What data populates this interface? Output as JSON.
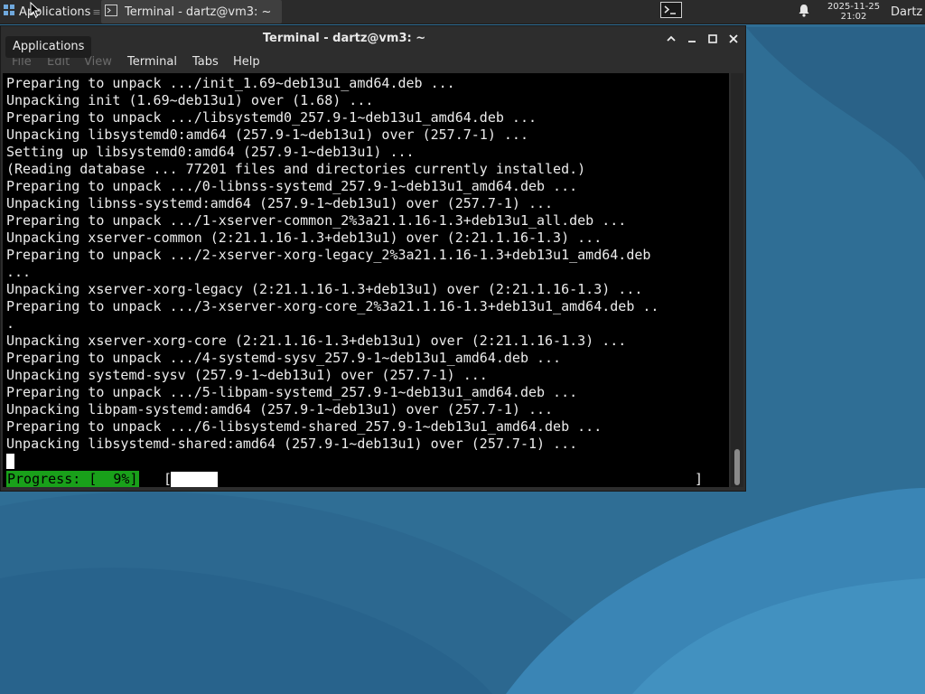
{
  "panel": {
    "applications_label": "Applications",
    "applications_separator": "≡",
    "task_label": "Terminal - dartz@vm3: ~",
    "clock_date": "2025-11-25",
    "clock_time": "21:02",
    "user": "Dartz",
    "icons": [
      "applications-icon",
      "terminal-task-icon",
      "terminal-launcher-icon",
      "notification-bell-icon"
    ]
  },
  "tooltip": {
    "text": "Applications"
  },
  "window": {
    "title": "Terminal - dartz@vm3: ~",
    "controls": [
      "raise-icon",
      "minimize-icon",
      "maximize-icon",
      "close-icon"
    ],
    "menu": [
      "File",
      "Edit",
      "View",
      "Terminal",
      "Tabs",
      "Help"
    ]
  },
  "terminal": {
    "lines": [
      "Preparing to unpack .../init_1.69~deb13u1_amd64.deb ...",
      "Unpacking init (1.69~deb13u1) over (1.68) ...",
      "Preparing to unpack .../libsystemd0_257.9-1~deb13u1_amd64.deb ...",
      "Unpacking libsystemd0:amd64 (257.9-1~deb13u1) over (257.7-1) ...",
      "Setting up libsystemd0:amd64 (257.9-1~deb13u1) ...",
      "(Reading database ... 77201 files and directories currently installed.)",
      "Preparing to unpack .../0-libnss-systemd_257.9-1~deb13u1_amd64.deb ...",
      "Unpacking libnss-systemd:amd64 (257.9-1~deb13u1) over (257.7-1) ...",
      "Preparing to unpack .../1-xserver-common_2%3a21.1.16-1.3+deb13u1_all.deb ...",
      "Unpacking xserver-common (2:21.1.16-1.3+deb13u1) over (2:21.1.16-1.3) ...",
      "Preparing to unpack .../2-xserver-xorg-legacy_2%3a21.1.16-1.3+deb13u1_amd64.deb",
      "...",
      "Unpacking xserver-xorg-legacy (2:21.1.16-1.3+deb13u1) over (2:21.1.16-1.3) ...",
      "Preparing to unpack .../3-xserver-xorg-core_2%3a21.1.16-1.3+deb13u1_amd64.deb ..",
      ".",
      "Unpacking xserver-xorg-core (2:21.1.16-1.3+deb13u1) over (2:21.1.16-1.3) ...",
      "Preparing to unpack .../4-systemd-sysv_257.9-1~deb13u1_amd64.deb ...",
      "Unpacking systemd-sysv (257.9-1~deb13u1) over (257.7-1) ...",
      "Preparing to unpack .../5-libpam-systemd_257.9-1~deb13u1_amd64.deb ...",
      "Unpacking libpam-systemd:amd64 (257.9-1~deb13u1) over (257.7-1) ...",
      "Preparing to unpack .../6-libsystemd-shared_257.9-1~deb13u1_amd64.deb ...",
      "Unpacking libsystemd-shared:amd64 (257.9-1~deb13u1) over (257.7-1) ..."
    ],
    "progress_label": "Progress: [  9%]",
    "progress_open": "[",
    "progress_close": "]",
    "progress_fraction": 0.09
  },
  "colors": {
    "panel_bg": "#2b2b2b",
    "terminal_bg": "#000000",
    "progress_label_bg": "#19a01a",
    "wallpaper_base": "#2f6d94"
  }
}
